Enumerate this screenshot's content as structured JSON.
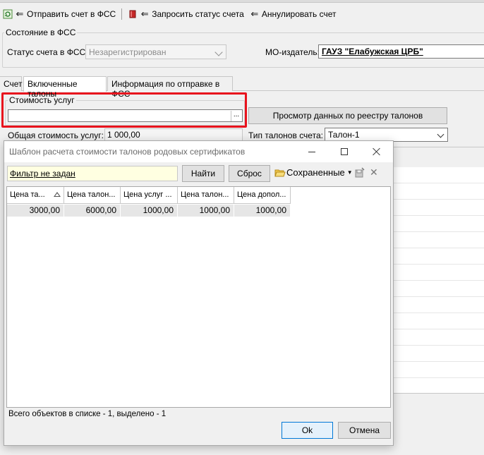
{
  "toolbar": {
    "send_label": "Отправить счет в ФСС",
    "request_status_label": "Запросить статус счета",
    "cancel_label": "Аннулировать счет"
  },
  "fss_state": {
    "group_title": "Состояние в ФСС",
    "status_label": "Статус счета в ФСС",
    "status_value": "Незарегистрирован",
    "mo_label": "МО-издатель:",
    "mo_value": "ГАУЗ \"Елабужская ЦРБ\""
  },
  "tabs": [
    {
      "label": "Счет"
    },
    {
      "label": "Включенные талоны"
    },
    {
      "label": "Информация по отправке в ФСС"
    }
  ],
  "services": {
    "group_title": "Стоимость услуг",
    "input_value": "",
    "ellipsis": "...",
    "view_registry_button": "Просмотр данных по реестру талонов",
    "total_label": "Общая стоимость услуг:",
    "total_value": "1 000,00",
    "ticket_type_label": "Тип талонов счета:",
    "ticket_type_value": "Талон-1"
  },
  "dialog": {
    "title": "Шаблон расчета стоимости талонов родовых сертификатов",
    "filter_text": "Фильтр не задан",
    "find_button": "Найти",
    "reset_button": "Сброс",
    "saved_label": "Сохраненные",
    "columns": [
      "Цена та...",
      "Цена талон...",
      "Цена услуг ...",
      "Цена талон...",
      "Цена допол..."
    ],
    "rows": [
      [
        "3000,00",
        "6000,00",
        "1000,00",
        "1000,00",
        "1000,00"
      ]
    ],
    "status_text": "Всего объектов в списке - 1, выделено - 1",
    "ok_button": "Ok",
    "cancel_button": "Отмена"
  },
  "colors": {
    "highlight": "#e8131d",
    "filter_bg": "#ffffe1",
    "selected_row": "#e6e6e6"
  }
}
